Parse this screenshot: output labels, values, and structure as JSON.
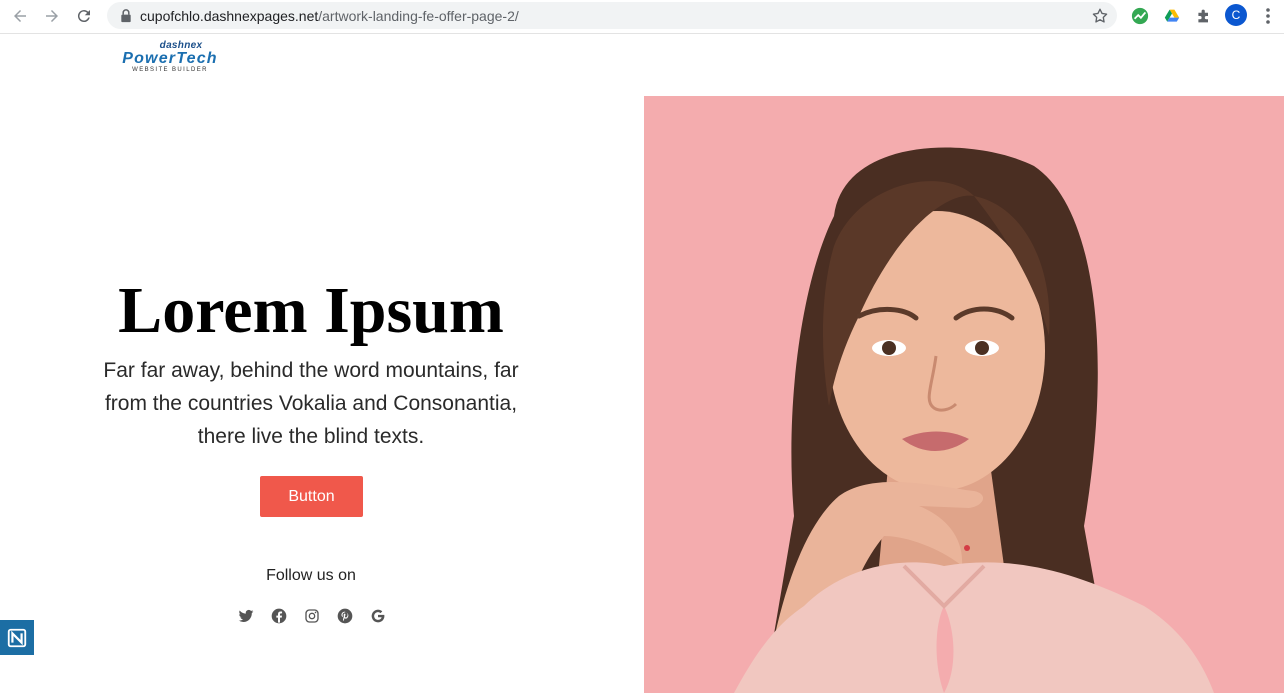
{
  "browser": {
    "url_host": "cupofchlo.dashnexpages.net",
    "url_path": "/artwork-landing-fe-offer-page-2/",
    "profile_initial": "C",
    "nav_icons": [
      "back-arrow-icon",
      "forward-arrow-icon",
      "reload-icon"
    ],
    "extension_icons": [
      "chart-extension-icon",
      "google-drive-icon",
      "puzzle-extensions-icon"
    ]
  },
  "logo": {
    "top": "dashnex",
    "main": "PowerTech",
    "sub": "WEBSITE BUILDER"
  },
  "hero": {
    "title": "Lorem Ipsum",
    "text": "Far far away, behind the word mountains, far from the countries Vokalia and Consonantia, there live the blind texts.",
    "button_label": "Button",
    "follow_label": "Follow us on",
    "social_icons": [
      "twitter-icon",
      "facebook-icon",
      "instagram-icon",
      "pinterest-icon",
      "google-icon"
    ]
  },
  "colors": {
    "accent": "#f0584b",
    "photo_bg": "#f4acae",
    "badge": "#1c6ea4"
  }
}
